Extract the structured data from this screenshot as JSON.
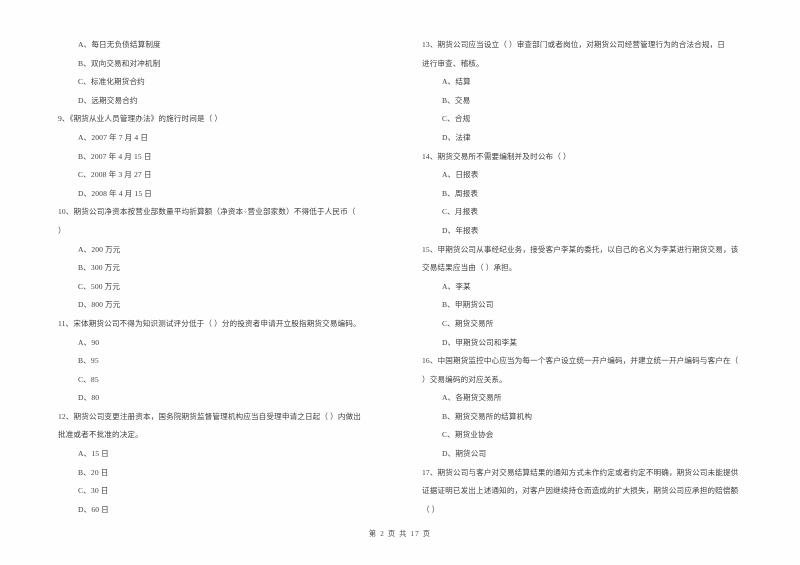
{
  "document": {
    "page_footer": {
      "prefix": "第",
      "current_page": "2",
      "middle": "页  共",
      "total_pages": "17",
      "suffix": "页"
    }
  },
  "left_column": {
    "continued_options": [
      "A、每日无负债结算制度",
      "B、双向交易和对冲机制",
      "C、标准化期货合约",
      "D、远期交易合约"
    ],
    "questions": [
      {
        "number": "9",
        "stem_lines": [
          "9、《期货从业人员管理办法》的施行时间是（     ）"
        ],
        "options": [
          "A、2007 年 7 月 4 日",
          "B、2007 年 4 月 15 日",
          "C、2008 年 3 月 27 日",
          "D、2008 年 4 月 15 日"
        ]
      },
      {
        "number": "10",
        "stem_lines": [
          "10、期货公司净资本按营业部数量平均折算额（净资本÷营业部家数）不得低于人民币（",
          "）"
        ],
        "options": [
          "A、200 万元",
          "B、300 万元",
          "C、500 万元",
          "D、800 万元"
        ]
      },
      {
        "number": "11",
        "stem_lines": [
          "11、宋体期货公司不得为知识测试评分低于（     ）分的投资者申请开立股指期货交易编码。"
        ],
        "options": [
          "A、90",
          "B、95",
          "C、85",
          "D、80"
        ]
      },
      {
        "number": "12",
        "stem_lines": [
          "12、期货公司变更注册资本，国务院期货监督管理机构应当自受理申请之日起（     ）内做出",
          "批准或者不批准的决定。"
        ],
        "options": [
          "A、15 日",
          "B、20 日",
          "C、30 日",
          "D、60 日"
        ]
      }
    ]
  },
  "right_column": {
    "questions": [
      {
        "number": "13",
        "stem_lines": [
          "13、期货公司应当设立（     ）审查部门或者岗位，对期货公司经营管理行为的合法合规，日",
          "进行审查、稽核。"
        ],
        "options": [
          "A、结算",
          "B、交易",
          "C、合规",
          "D、法律"
        ]
      },
      {
        "number": "14",
        "stem_lines": [
          "14、期货交易所不需要编制并及时公布（     ）"
        ],
        "options": [
          "A、日报表",
          "B、周报表",
          "C、月报表",
          "D、年报表"
        ]
      },
      {
        "number": "15",
        "stem_lines": [
          "15、甲期货公司从事经纪业务，接受客户李某的委托，以自己的名义为李某进行期货交易，该",
          "交易结果应当由（     ）承担。"
        ],
        "options": [
          "A、李某",
          "B、甲期货公司",
          "C、期货交易所",
          "D、甲期货公司和李某"
        ]
      },
      {
        "number": "16",
        "stem_lines": [
          "16、中国期货监控中心应当为每一个客户设立统一开户编码，并建立统一开户编码与客户在（",
          "）交易编码的对应关系。"
        ],
        "options": [
          "A、各期货交易所",
          "B、期货交易所的结算机构",
          "C、期货业协会",
          "D、期货公司"
        ]
      },
      {
        "number": "17",
        "stem_lines": [
          "17、期货公司与客户对交易结算结果的通知方式未作约定或者约定不明确，期货公司未能提供",
          "证据证明已发出上述通知的，对客户因继续持仓而造成的扩大损失，期货公司应承担的赔偿额",
          "（     ）"
        ],
        "options": []
      }
    ]
  }
}
